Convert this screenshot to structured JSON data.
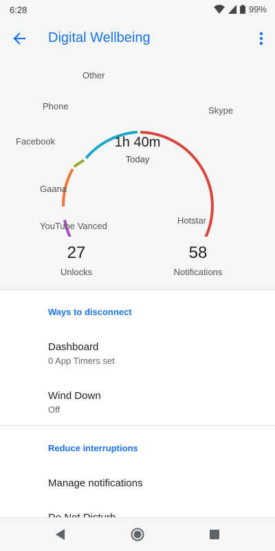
{
  "status": {
    "time": "6:28",
    "battery": "99%"
  },
  "appbar": {
    "title": "Digital Wellbeing"
  },
  "usage": {
    "total": "1h 40m",
    "period": "Today",
    "apps": [
      {
        "name": "Other",
        "color": "#1aa8c9"
      },
      {
        "name": "Skype",
        "color": "#d9453c"
      },
      {
        "name": "Hotstar",
        "color": "#f2b51b"
      },
      {
        "name": "YouTube Vanced",
        "color": "#0f9d58"
      },
      {
        "name": "Gaana",
        "color": "#a94bc5"
      },
      {
        "name": "Facebook",
        "color": "#f0763a"
      },
      {
        "name": "Phone",
        "color": "#a0a937"
      }
    ]
  },
  "stats": {
    "unlocks": {
      "value": "27",
      "label": "Unlocks"
    },
    "notifications": {
      "value": "58",
      "label": "Notifications"
    }
  },
  "sections": {
    "ways_to_disconnect": "Ways to disconnect",
    "reduce_interruptions": "Reduce interruptions"
  },
  "items": {
    "dashboard": {
      "title": "Dashboard",
      "subtitle": "0 App Timers set"
    },
    "wind_down": {
      "title": "Wind Down",
      "subtitle": "Off"
    },
    "manage_notifications": {
      "title": "Manage notifications"
    },
    "do_not_disturb": {
      "title": "Do Not Disturb"
    }
  }
}
